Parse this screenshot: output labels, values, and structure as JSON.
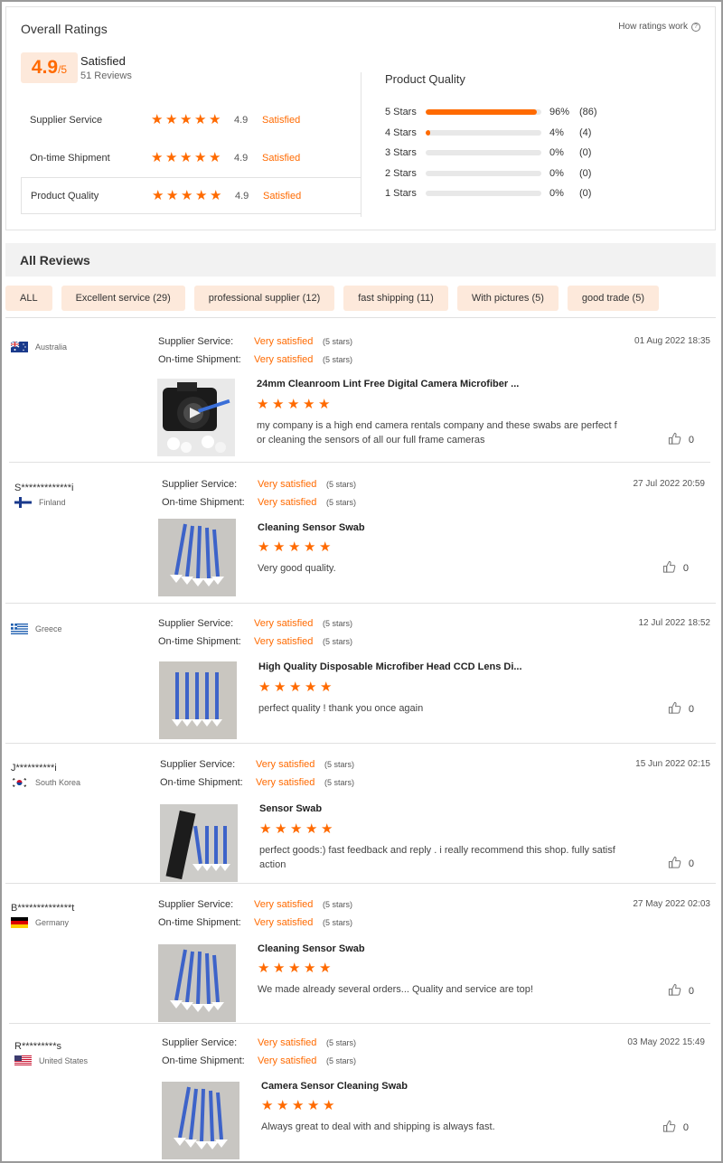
{
  "overall": {
    "title": "Overall Ratings",
    "how_link": "How ratings work",
    "score": "4.9",
    "score_suffix": "/5",
    "satisfaction": "Satisfied",
    "review_count": "51 Reviews",
    "sub_ratings": [
      {
        "label": "Supplier Service",
        "stars": 5,
        "score": "4.9",
        "status": "Satisfied"
      },
      {
        "label": "On-time Shipment",
        "stars": 5,
        "score": "4.9",
        "status": "Satisfied"
      },
      {
        "label": "Product Quality",
        "stars": 5,
        "score": "4.9",
        "status": "Satisfied"
      }
    ]
  },
  "product_quality": {
    "title": "Product Quality",
    "distribution": [
      {
        "label": "5 Stars",
        "percent": 96,
        "percent_text": "96%",
        "count": "(86)"
      },
      {
        "label": "4 Stars",
        "percent": 4,
        "percent_text": "4%",
        "count": "(4)"
      },
      {
        "label": "3 Stars",
        "percent": 0,
        "percent_text": "0%",
        "count": "(0)"
      },
      {
        "label": "2 Stars",
        "percent": 0,
        "percent_text": "0%",
        "count": "(0)"
      },
      {
        "label": "1 Stars",
        "percent": 0,
        "percent_text": "0%",
        "count": "(0)"
      }
    ]
  },
  "all_reviews": {
    "title": "All Reviews",
    "filters": [
      "ALL",
      "Excellent service (29)",
      "professional supplier (12)",
      "fast shipping (11)",
      "With pictures (5)",
      "good trade (5)"
    ]
  },
  "labels": {
    "supplier_service": "Supplier Service:",
    "ontime_shipment": "On-time Shipment:",
    "very_satisfied": "Very satisfied",
    "five_stars": "(5 stars)"
  },
  "reviews": [
    {
      "user": "",
      "country": "Australia",
      "flag": "australia",
      "date": "01 Aug 2022 18:35",
      "product": "24mm Cleanroom Lint Free Digital Camera Microfiber ...",
      "stars": 5,
      "text_lines": [
        "my company is a high end camera rentals company and these swabs are perfect f",
        "or cleaning the sensors of all our full frame cameras"
      ],
      "likes": "0",
      "thumb": "camera"
    },
    {
      "user": "S*************i",
      "country": "Finland",
      "flag": "finland",
      "date": "27 Jul 2022 20:59",
      "product": "Cleaning Sensor Swab",
      "stars": 5,
      "text_lines": [
        "Very good quality."
      ],
      "likes": "0",
      "thumb": "swabs-fan"
    },
    {
      "user": "",
      "country": "Greece",
      "flag": "greece",
      "date": "12 Jul 2022 18:52",
      "product": "High Quality Disposable Microfiber Head CCD Lens Di...",
      "stars": 5,
      "text_lines": [
        "perfect quality ! thank you once again"
      ],
      "likes": "0",
      "thumb": "swabs-row"
    },
    {
      "user": "J**********i",
      "country": "South Korea",
      "flag": "korea",
      "date": "15 Jun 2022 02:15",
      "product": "Sensor Swab",
      "stars": 5,
      "text_lines": [
        "perfect goods:) fast feedback and reply . i really recommend this shop. fully satisf",
        "action"
      ],
      "likes": "0",
      "thumb": "swabs-pack"
    },
    {
      "user": "B**************t",
      "country": "Germany",
      "flag": "germany",
      "date": "27 May 2022 02:03",
      "product": "Cleaning Sensor Swab",
      "stars": 5,
      "text_lines": [
        "We made already several orders... Quality and service are top!"
      ],
      "likes": "0",
      "thumb": "swabs-fan"
    },
    {
      "user": "R*********s",
      "country": "United States",
      "flag": "usa",
      "date": "03 May 2022 15:49",
      "product": "Camera Sensor Cleaning Swab",
      "stars": 5,
      "text_lines": [
        "Always great to deal with and shipping is always fast."
      ],
      "likes": "0",
      "thumb": "swabs-fan"
    }
  ],
  "colors": {
    "accent": "#ff6a00",
    "accent_bg": "#fde9db"
  }
}
